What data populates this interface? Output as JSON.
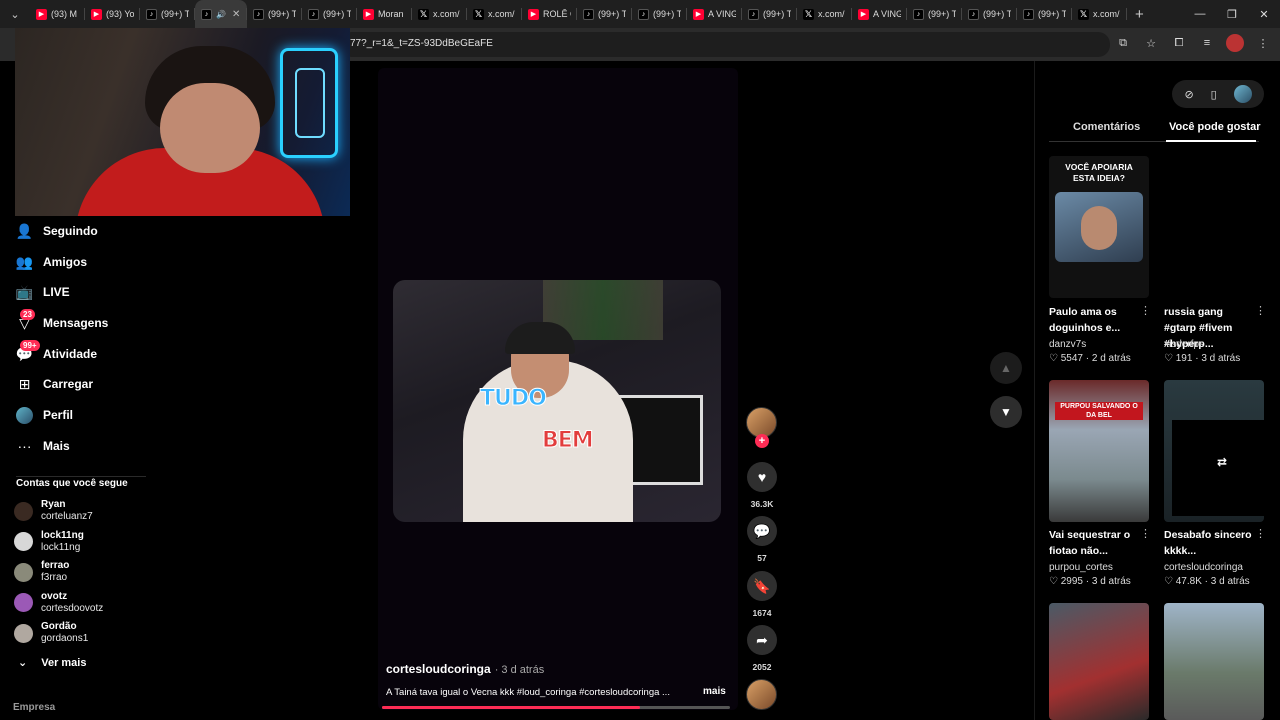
{
  "tabs": [
    {
      "icon": "yt",
      "label": "(93) M"
    },
    {
      "icon": "yt",
      "label": "(93) Yo"
    },
    {
      "icon": "tt",
      "label": "(99+) T"
    },
    {
      "icon": "tt",
      "label": "",
      "active": true
    },
    {
      "icon": "tt",
      "label": "(99+) T"
    },
    {
      "icon": "tt",
      "label": "(99+) T"
    },
    {
      "icon": "yt",
      "label": "Moran"
    },
    {
      "icon": "x",
      "label": "x.com/"
    },
    {
      "icon": "x",
      "label": "x.com/"
    },
    {
      "icon": "yt",
      "label": "ROLÊ C"
    },
    {
      "icon": "tt",
      "label": "(99+) T"
    },
    {
      "icon": "tt",
      "label": "(99+) T"
    },
    {
      "icon": "yt",
      "label": "A VING"
    },
    {
      "icon": "tt",
      "label": "(99+) T"
    },
    {
      "icon": "x",
      "label": "x.com/"
    },
    {
      "icon": "yt",
      "label": "A VING"
    },
    {
      "icon": "tt",
      "label": "(99+) T"
    },
    {
      "icon": "tt",
      "label": "(99+) T"
    },
    {
      "icon": "tt",
      "label": "(99+) T"
    },
    {
      "icon": "x",
      "label": "x.com/"
    }
  ],
  "address": {
    "url": "77?_r=1&_t=ZS-93DdBeGEaFE"
  },
  "sidebar": {
    "nav": [
      {
        "icon": "following-icon",
        "glyph": "👤",
        "label": "Seguindo"
      },
      {
        "icon": "friends-icon",
        "glyph": "👥",
        "label": "Amigos"
      },
      {
        "icon": "live-icon",
        "glyph": "📺",
        "label": "LIVE"
      },
      {
        "icon": "messages-icon",
        "glyph": "▽",
        "label": "Mensagens",
        "badge": "23"
      },
      {
        "icon": "activity-icon",
        "glyph": "💬",
        "label": "Atividade",
        "badge": "99+"
      },
      {
        "icon": "upload-icon",
        "glyph": "⊞",
        "label": "Carregar"
      },
      {
        "icon": "profile-icon",
        "glyph": "",
        "label": "Perfil"
      },
      {
        "icon": "more-icon",
        "glyph": "···",
        "label": "Mais"
      }
    ],
    "following_title": "Contas que você segue",
    "accounts": [
      {
        "name": "Ryan",
        "handle": "corteluanz7",
        "color": "#3a2a22"
      },
      {
        "name": "lock11ng",
        "handle": "lock11ng",
        "color": "#d8d8d8"
      },
      {
        "name": "ferrao",
        "handle": "f3rrao",
        "color": "#8a8a7a"
      },
      {
        "name": "ovotz",
        "handle": "cortesdoovotz",
        "color": "#9b59b6"
      },
      {
        "name": "Gordão",
        "handle": "gordaons1",
        "color": "#b0a8a0"
      }
    ],
    "see_more": "Ver mais",
    "footer": "Empresa"
  },
  "video": {
    "caption_top": "TUDO",
    "caption_bottom": "BEM",
    "author": "cortesloudcoringa",
    "time": "· 3 d atrás",
    "description": "A Tainá tava igual o Vecna kkk #loud_coringa #cortesloudcoringa ...",
    "more": "mais",
    "progress_fraction": 0.74
  },
  "actions": {
    "likes": "36.3K",
    "comments": "57",
    "saves": "1674",
    "shares": "2052"
  },
  "rightpanel": {
    "tab_comments": "Comentários",
    "tab_recommended": "Você pode gostar",
    "items": [
      {
        "title": "Paulo ama os doguinhos e...",
        "author": "danzv7s",
        "stats": "♡ 5547 · 2 d atrás",
        "thumb_text": "VOCÊ APOIARIA ESTA IDEIA?"
      },
      {
        "title": "russia gang #gtarp #fivem #hyperp...",
        "author": "xisderfps",
        "stats": "♡ 191 · 3 d atrás",
        "thumb_text": ""
      },
      {
        "title": "Vai sequestrar o fiotao não...",
        "author": "purpou_cortes",
        "stats": "♡ 2995 · 3 d atrás",
        "thumb_text": "PURPOU SALVANDO O DA BEL"
      },
      {
        "title": "Desabafo sincero kkkk...",
        "author": "cortesloudcoringa",
        "stats": "♡ 47.8K · 3 d atrás",
        "thumb_text": ""
      }
    ]
  },
  "colors": {
    "accent": "#fe2c55",
    "bg": "#000000"
  }
}
